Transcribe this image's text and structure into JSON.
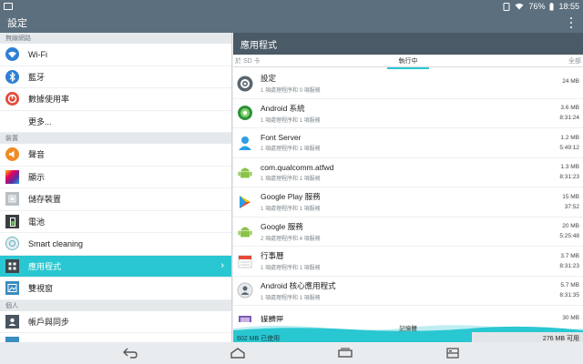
{
  "status": {
    "battery": "76%",
    "time": "18:55"
  },
  "actionbar": {
    "title": "設定"
  },
  "sections": {
    "wireless": "無線網路",
    "device": "裝置",
    "personal": "個人"
  },
  "settings": {
    "wifi": "Wi-Fi",
    "bluetooth": "藍牙",
    "data_usage": "數據使用率",
    "more": "更多...",
    "sound": "聲音",
    "display": "顯示",
    "storage": "儲存裝置",
    "battery": "電池",
    "smart_cleaning": "Smart cleaning",
    "apps": "應用程式",
    "dual_window": "雙視窗",
    "accounts_sync": "帳戶與同步"
  },
  "right": {
    "title": "應用程式",
    "tabs": {
      "sd": "於 SD 卡",
      "running": "執行中",
      "all": "全部"
    }
  },
  "apps": [
    {
      "name": "設定",
      "sub": "1 項處理程序和 0 項服務",
      "size": "24 MB",
      "time": ""
    },
    {
      "name": "Android 系統",
      "sub": "1 項處理程序和 1 項服務",
      "size": "3.6 MB",
      "time": "8:31:24"
    },
    {
      "name": "Font Server",
      "sub": "1 項處理程序和 1 項服務",
      "size": "1.2 MB",
      "time": "5:49:12"
    },
    {
      "name": "com.qualcomm.atfwd",
      "sub": "1 項處理程序和 1 項服務",
      "size": "1.3 MB",
      "time": "8:31:23"
    },
    {
      "name": "Google Play 服務",
      "sub": "1 項處理程序和 1 項服務",
      "size": "15 MB",
      "time": "37:52"
    },
    {
      "name": "Google 服務",
      "sub": "2 項處理程序和 4 項服務",
      "size": "20 MB",
      "time": "5:25:48"
    },
    {
      "name": "行事曆",
      "sub": "1 項處理程序和 1 項服務",
      "size": "3.7 MB",
      "time": "8:31:23"
    },
    {
      "name": "Android 核心應用程式",
      "sub": "1 項處理程序和 1 項服務",
      "size": "5.7 MB",
      "time": "8:31:35"
    },
    {
      "name": "媒體匣",
      "sub": "",
      "size": "30 MB",
      "time": ""
    }
  ],
  "memory": {
    "label": "記憶體",
    "used": "602 MB 已使用",
    "free": "276 MB 可用"
  },
  "colors": {
    "accent": "#29c7d1",
    "header": "#4a5a66",
    "statusbar": "#5c6f7e"
  }
}
